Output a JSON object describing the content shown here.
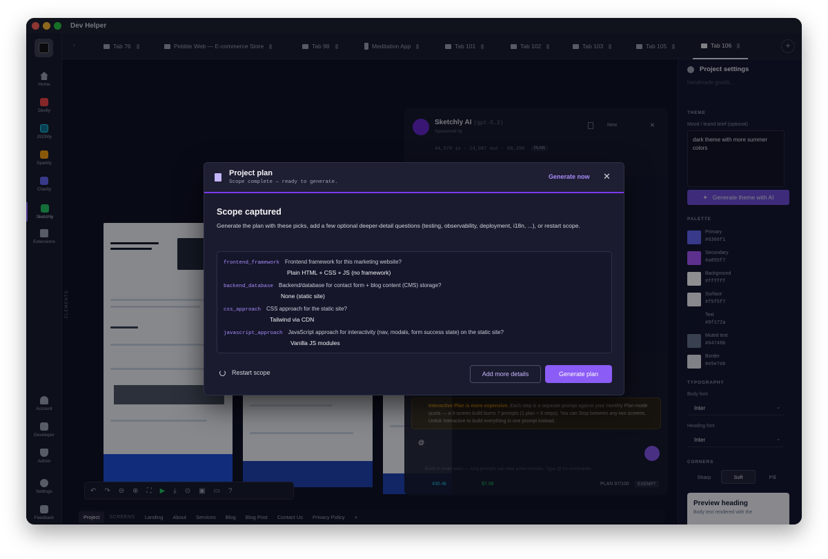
{
  "app": {
    "title": "Dev Helper"
  },
  "colors": {
    "accent": "#8b5cf6",
    "window_bg": "#0c0f1f"
  },
  "rail": {
    "items": [
      {
        "label": "Home",
        "icon": "home-icon"
      },
      {
        "label": "Devlly",
        "icon": "devlly-icon"
      },
      {
        "label": "JSONly",
        "icon": "jsonly-icon"
      },
      {
        "label": "Sparkly",
        "icon": "sparkly-icon"
      },
      {
        "label": "Charity",
        "icon": "charity-icon"
      },
      {
        "label": "Sketchly",
        "icon": "sketchly-icon"
      },
      {
        "label": "Extensions",
        "icon": "puzzle-icon"
      }
    ],
    "bottom": [
      {
        "label": "Account",
        "icon": "user-icon"
      },
      {
        "label": "Developer",
        "icon": "tools-icon"
      },
      {
        "label": "Admin",
        "icon": "shield-icon"
      },
      {
        "label": "Settings",
        "icon": "gear-icon"
      },
      {
        "label": "Feedback",
        "icon": "chat-icon"
      }
    ]
  },
  "tabs": [
    "Tab 76",
    "Pebble Web — E-commerce Store",
    "Tab 98",
    "Meditation App",
    "Tab 101",
    "Tab 102",
    "Tab 103",
    "Tab 105",
    "Tab 106"
  ],
  "canvas": {
    "elements_label": "ELEMENTS"
  },
  "bottom_bar": {
    "items": [
      "Project",
      "SCREENS",
      "Landing",
      "About",
      "Services",
      "Blog",
      "Blog Post",
      "Contact Us",
      "Privacy Policy",
      "+"
    ]
  },
  "chat": {
    "title": "Sketchly AI",
    "model": "(gpt-5.2)",
    "sponsored": "Sponsored by",
    "new_label": "New",
    "usage": "44,570 in · 14,087 out · 60,290",
    "plan_badge": "PLAN",
    "warning_title": "Interactive Plan is more expensive.",
    "warning_text": "Each step is a separate prompt against your monthly Plan-mode quota — a 6-screen build burns 7 prompts (1 plan + 6 steps). You can Stop between any two screens. Untick Interactive to build everything in one prompt instead.",
    "input_value": "@",
    "hint": "Build in small steps — long prompts can take a few minutes. Type @ for commands.",
    "footer_left": "430.4k",
    "footer_mid": "$7.08",
    "footer_plan": "PLAN 97/100",
    "footer_badge": "EXEMPT"
  },
  "settings": {
    "title": "Project settings",
    "faded_text": "handmade goods...",
    "theme_label": "THEME",
    "mood_label": "Mood / brand brief (optional)",
    "mood_value": "dark theme with more summer colors",
    "generate_theme": "Generate theme with AI",
    "palette_label": "PALETTE",
    "palette": [
      {
        "name": "Primary",
        "hex": "#6366f1"
      },
      {
        "name": "Secondary",
        "hex": "#a855f7"
      },
      {
        "name": "Background",
        "hex": "#ffffff"
      },
      {
        "name": "Surface",
        "hex": "#f5f5f7"
      },
      {
        "name": "Text",
        "hex": "#0f172a"
      },
      {
        "name": "Muted text",
        "hex": "#64748b"
      },
      {
        "name": "Border",
        "hex": "#e5e7eb"
      }
    ],
    "typography_label": "TYPOGRAPHY",
    "body_font_label": "Body font",
    "body_font": "Inter",
    "heading_font_label": "Heading font",
    "heading_font": "Inter",
    "corners_label": "CORNERS",
    "corners": [
      "Sharp",
      "Soft",
      "Pill"
    ],
    "corners_selected": "Soft",
    "preview_heading": "Preview heading",
    "preview_body": "Body text rendered with the"
  },
  "modal": {
    "title": "Project plan",
    "subtitle": "Scope complete — ready to generate.",
    "generate_now": "Generate now",
    "heading": "Scope captured",
    "description": "Generate the plan with these picks, add a few optional deeper-detail questions (testing, observability, deployment, i18n, ...), or restart scope.",
    "questions": [
      {
        "key": "frontend_framework",
        "question": "Frontend framework for this marketing website?",
        "answer": "Plain HTML + CSS + JS (no framework)"
      },
      {
        "key": "backend_database",
        "question": "Backend/database for contact form + blog content (CMS) storage?",
        "answer": "None (static site)"
      },
      {
        "key": "css_approach",
        "question": "CSS approach for the static site?",
        "answer": "Tailwind via CDN"
      },
      {
        "key": "javascript_approach",
        "question": "JavaScript approach for interactivity (nav, modals, form success state) on the static site?",
        "answer": "Vanilla JS modules"
      }
    ],
    "restart": "Restart scope",
    "add_details": "Add more details",
    "generate_plan": "Generate plan"
  }
}
